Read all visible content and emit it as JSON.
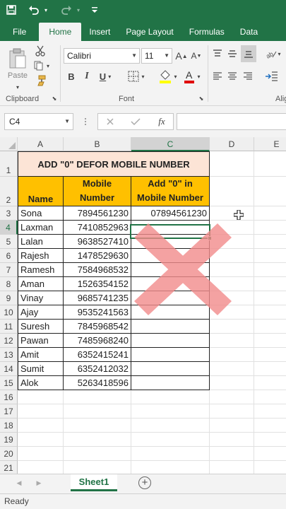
{
  "ribbon": {
    "tabs": [
      "File",
      "Home",
      "Insert",
      "Page Layout",
      "Formulas",
      "Data"
    ],
    "active_tab": "Home",
    "paste_label": "Paste",
    "font_name": "Calibri",
    "font_size": "11",
    "group_clipboard": "Clipboard",
    "group_font": "Font",
    "group_align": "Alig"
  },
  "formula_bar": {
    "name_box": "C4",
    "fx_label": "fx",
    "formula": ""
  },
  "sheet": {
    "columns": [
      "A",
      "B",
      "C",
      "D",
      "E"
    ],
    "rows": [
      "1",
      "2",
      "3",
      "4",
      "5",
      "6",
      "7",
      "8",
      "9",
      "10",
      "11",
      "12",
      "13",
      "14",
      "15",
      "16",
      "17",
      "18",
      "19",
      "20",
      "21"
    ],
    "title": "ADD \"0\" DEFOR MOBILE NUMBER",
    "header_name": "Name",
    "header_mobile": "Mobile Number",
    "header_add": "Add \"0\" in Mobile Number",
    "data": [
      {
        "name": "Sona",
        "mobile": "7894561230",
        "result": "07894561230"
      },
      {
        "name": "Laxman",
        "mobile": "7410852963",
        "result": ""
      },
      {
        "name": "Lalan",
        "mobile": "9638527410",
        "result": ""
      },
      {
        "name": "Rajesh",
        "mobile": "1478529630",
        "result": ""
      },
      {
        "name": "Ramesh",
        "mobile": "7584968532",
        "result": ""
      },
      {
        "name": "Aman",
        "mobile": "1526354152",
        "result": ""
      },
      {
        "name": "Vinay",
        "mobile": "9685741235",
        "result": ""
      },
      {
        "name": "Ajay",
        "mobile": "9535241563",
        "result": ""
      },
      {
        "name": "Suresh",
        "mobile": "7845968542",
        "result": ""
      },
      {
        "name": "Pawan",
        "mobile": "7485968240",
        "result": ""
      },
      {
        "name": "Amit",
        "mobile": "6352415241",
        "result": ""
      },
      {
        "name": "Sumit",
        "mobile": "6352412032",
        "result": ""
      },
      {
        "name": "Alok",
        "mobile": "5263418596",
        "result": ""
      }
    ]
  },
  "sheet_tab": "Sheet1",
  "status": "Ready",
  "colors": {
    "excel_green": "#217346",
    "title_fill": "#fce4d6",
    "header_fill": "#ffc000",
    "cross": "#f28b8b"
  }
}
